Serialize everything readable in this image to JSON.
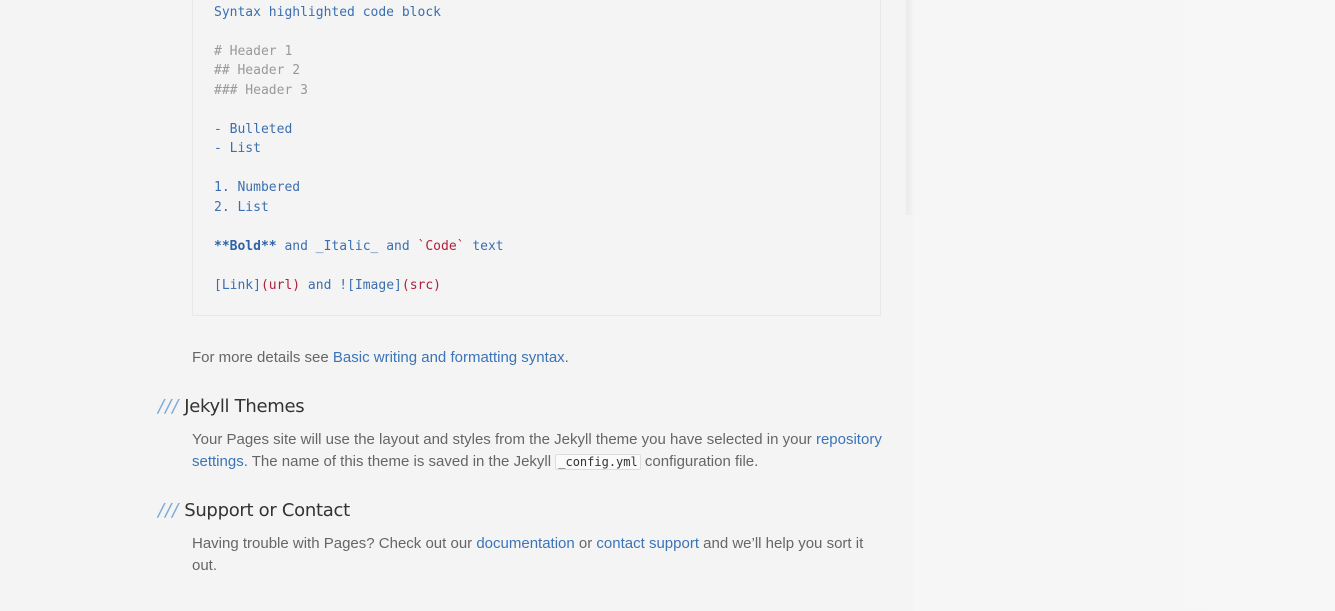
{
  "code_block": {
    "lines": {
      "l1": "Syntax highlighted code block",
      "l2": "# Header 1",
      "l3": "## Header 2",
      "l4": "### Header 3",
      "l5": "- Bulleted",
      "l6": "- List",
      "l7": "1. Numbered",
      "l8": "2. List",
      "l9_bold": "**Bold**",
      "l9_and1": " and ",
      "l9_italic": "_Italic_",
      "l9_and2": " and ",
      "l9_code": "`Code`",
      "l9_text": " text",
      "l10_link_a": "[Link]",
      "l10_link_b": "(url)",
      "l10_and": " and ",
      "l10_img_a": "![Image]",
      "l10_img_b": "(src)"
    }
  },
  "details": {
    "prefix": "For more details see ",
    "link": "Basic writing and formatting syntax",
    "suffix": "."
  },
  "jekyll": {
    "slashes": "///",
    "heading": "Jekyll Themes",
    "text1": "Your Pages site will use the layout and styles from the Jekyll theme you have selected in your ",
    "link1": "repository",
    "link1b": "settings",
    "text2": ". The name of this theme is saved in the Jekyll ",
    "code": "_config.yml",
    "text3": " configuration file."
  },
  "support": {
    "slashes": "///",
    "heading": "Support or Contact",
    "text1": "Having trouble with Pages? Check out our ",
    "link1": "documentation",
    "text2": " or ",
    "link2": "contact support",
    "text3": " and we’ll help you sort it",
    "text4": "out."
  }
}
